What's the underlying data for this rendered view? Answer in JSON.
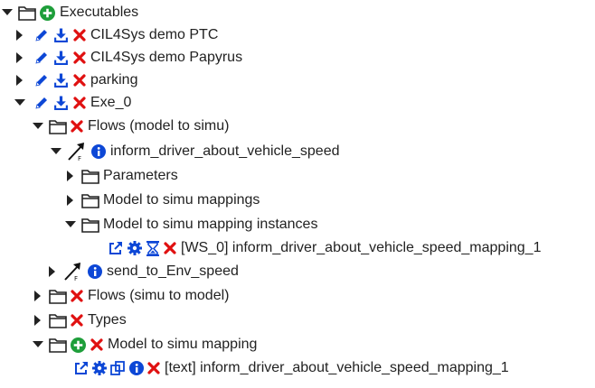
{
  "colors": {
    "blue": "#0d47d6",
    "red": "#e01010",
    "green": "#1e9e3a",
    "text": "#222222"
  },
  "tree": {
    "root_label": "Executables",
    "exe_ptc_label": "CIL4Sys demo PTC",
    "exe_papyrus_label": "CIL4Sys demo Papyrus",
    "exe_parking_label": "parking",
    "exe_0_label": "Exe_0",
    "flows_m2s_label": "Flows (model to simu)",
    "flow_inform_label": "inform_driver_about_vehicle_speed",
    "parameters_label": "Parameters",
    "m2s_mappings_label": "Model to simu mappings",
    "m2s_mapping_instances_label": "Model to simu mapping instances",
    "instance_label": "[WS_0] inform_driver_about_vehicle_speed_mapping_1",
    "flow_send_label": "send_to_Env_speed",
    "flows_s2m_label": "Flows (simu to model)",
    "types_label": "Types",
    "m2s_mapping_label": "Model to simu mapping",
    "text_mapping_label": "[text] inform_driver_about_vehicle_speed_mapping_1"
  }
}
